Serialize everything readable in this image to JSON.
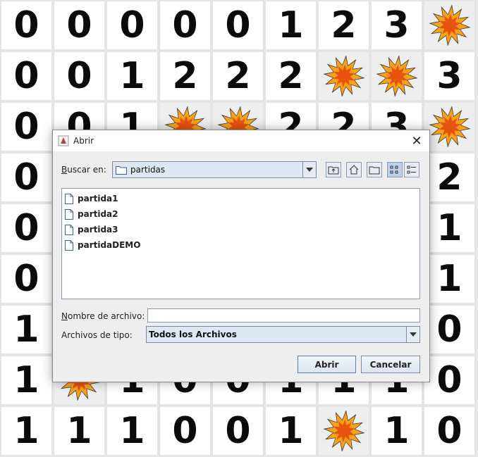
{
  "board": {
    "cells": [
      [
        "0",
        "0",
        "0",
        "0",
        "0",
        "1",
        "2",
        "3",
        "*"
      ],
      [
        "0",
        "0",
        "1",
        "2",
        "2",
        "2",
        "*",
        "*",
        "3"
      ],
      [
        "0",
        "0",
        "1",
        "*",
        "*",
        "2",
        "2",
        "3",
        "*"
      ],
      [
        "0",
        "",
        "",
        "",
        "",
        "",
        "",
        "",
        "2"
      ],
      [
        "0",
        "",
        "",
        "",
        "",
        "",
        "",
        "",
        "1"
      ],
      [
        "0",
        "",
        "",
        "",
        "",
        "",
        "",
        "",
        "1"
      ],
      [
        "1",
        "",
        "",
        "",
        "",
        "",
        "",
        "",
        "0"
      ],
      [
        "1",
        "*",
        "1",
        "0",
        "0",
        "1",
        "1",
        "1",
        "0"
      ],
      [
        "1",
        "1",
        "1",
        "0",
        "0",
        "1",
        "*",
        "1",
        "0"
      ]
    ],
    "mine_icon": "explosion-icon"
  },
  "dialog": {
    "title": "Abrir",
    "close_label": "✕",
    "look_in_label": "Buscar en:",
    "look_in_mnemonic": "B",
    "look_in_value": "partidas",
    "toolbar": [
      "up-one-level-icon",
      "home-icon",
      "new-folder-icon",
      "list-view-icon",
      "details-view-icon"
    ],
    "files": [
      "partida1",
      "partida2",
      "partida3",
      "partidaDEMO"
    ],
    "filename_label": "Nombre de archivo:",
    "filename_value": "",
    "filetype_label": "Archivos de tipo:",
    "filetype_value": "Todos los Archivos",
    "open_label": "Abrir",
    "cancel_label": "Cancelar"
  },
  "colors": {
    "mine_outer": "#f7a21a",
    "mine_inner": "#e8520f",
    "combo_bg": "#dfe7f2",
    "border_blue": "#7a8ba6"
  }
}
